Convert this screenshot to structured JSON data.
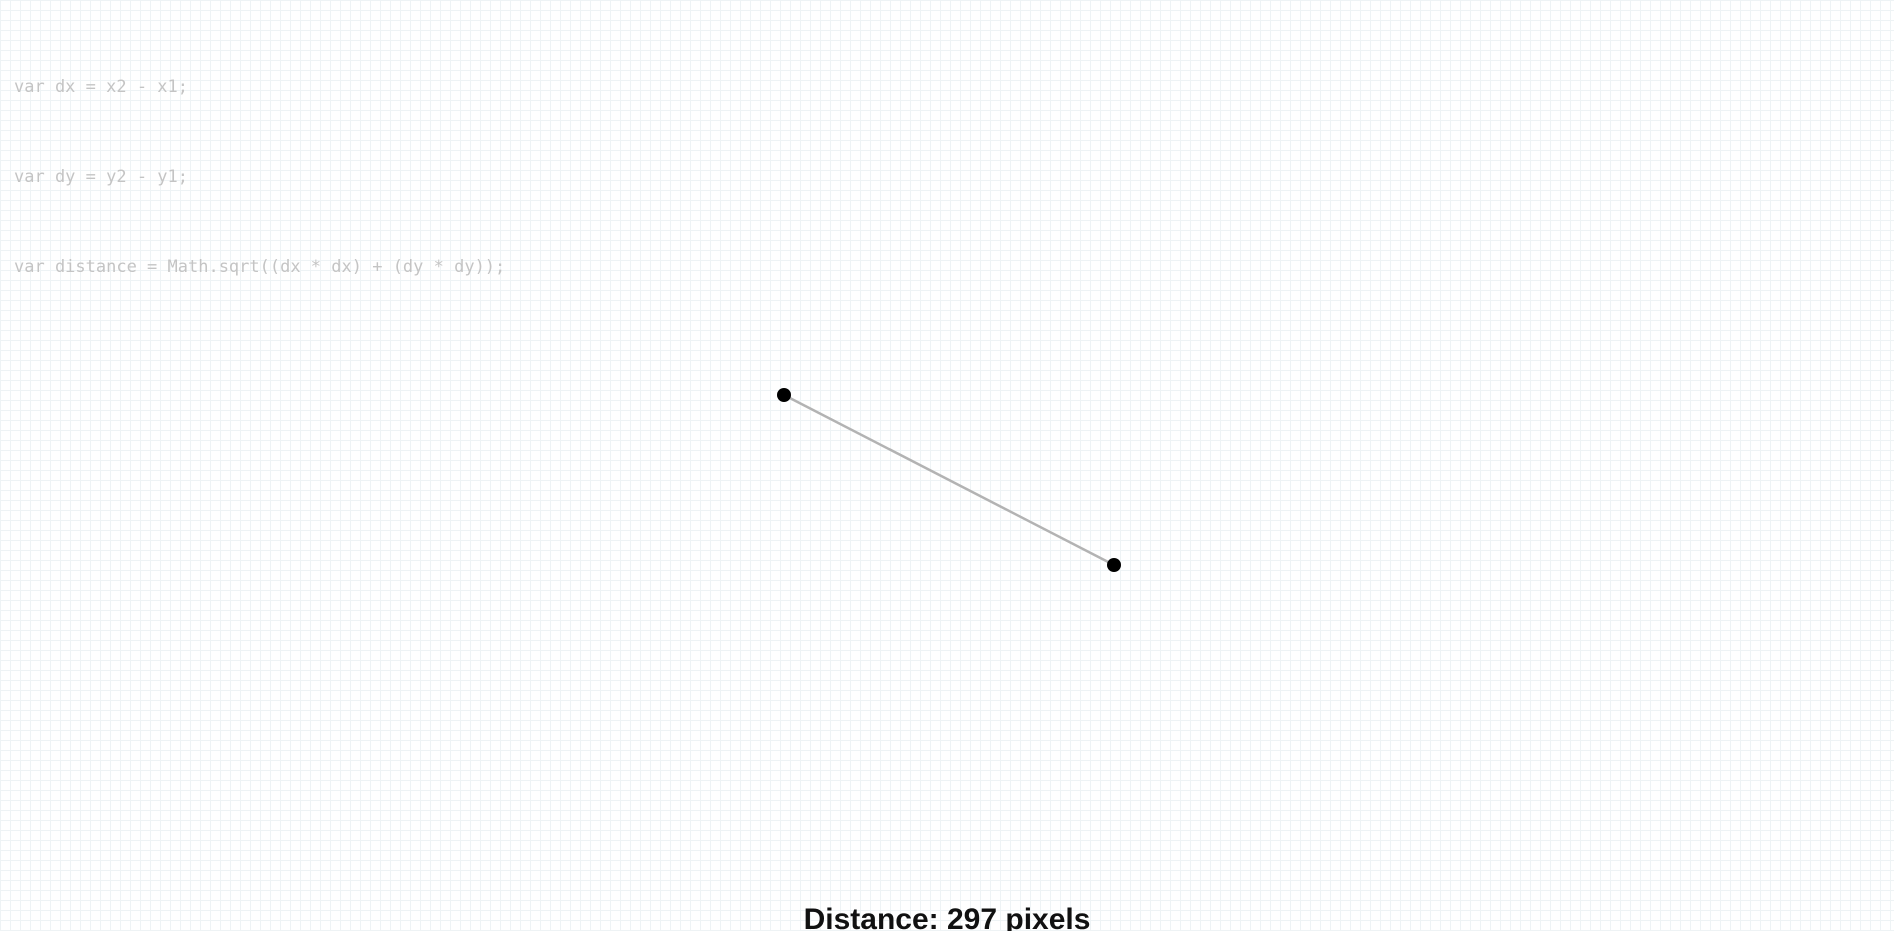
{
  "code": {
    "lines": [
      "var dx = x2 - x1;",
      "var dy = y2 - y1;",
      "var distance = Math.sqrt((dx * dx) + (dy * dy));"
    ]
  },
  "distance": {
    "prefix": "Distance: ",
    "value": "297",
    "unit": " pixels"
  },
  "colors": {
    "grid_line": "#eef3f5",
    "code_text": "#c4c4c4",
    "connector_line": "#b3b3b3",
    "point_fill": "#000000",
    "label_text": "#111111"
  }
}
